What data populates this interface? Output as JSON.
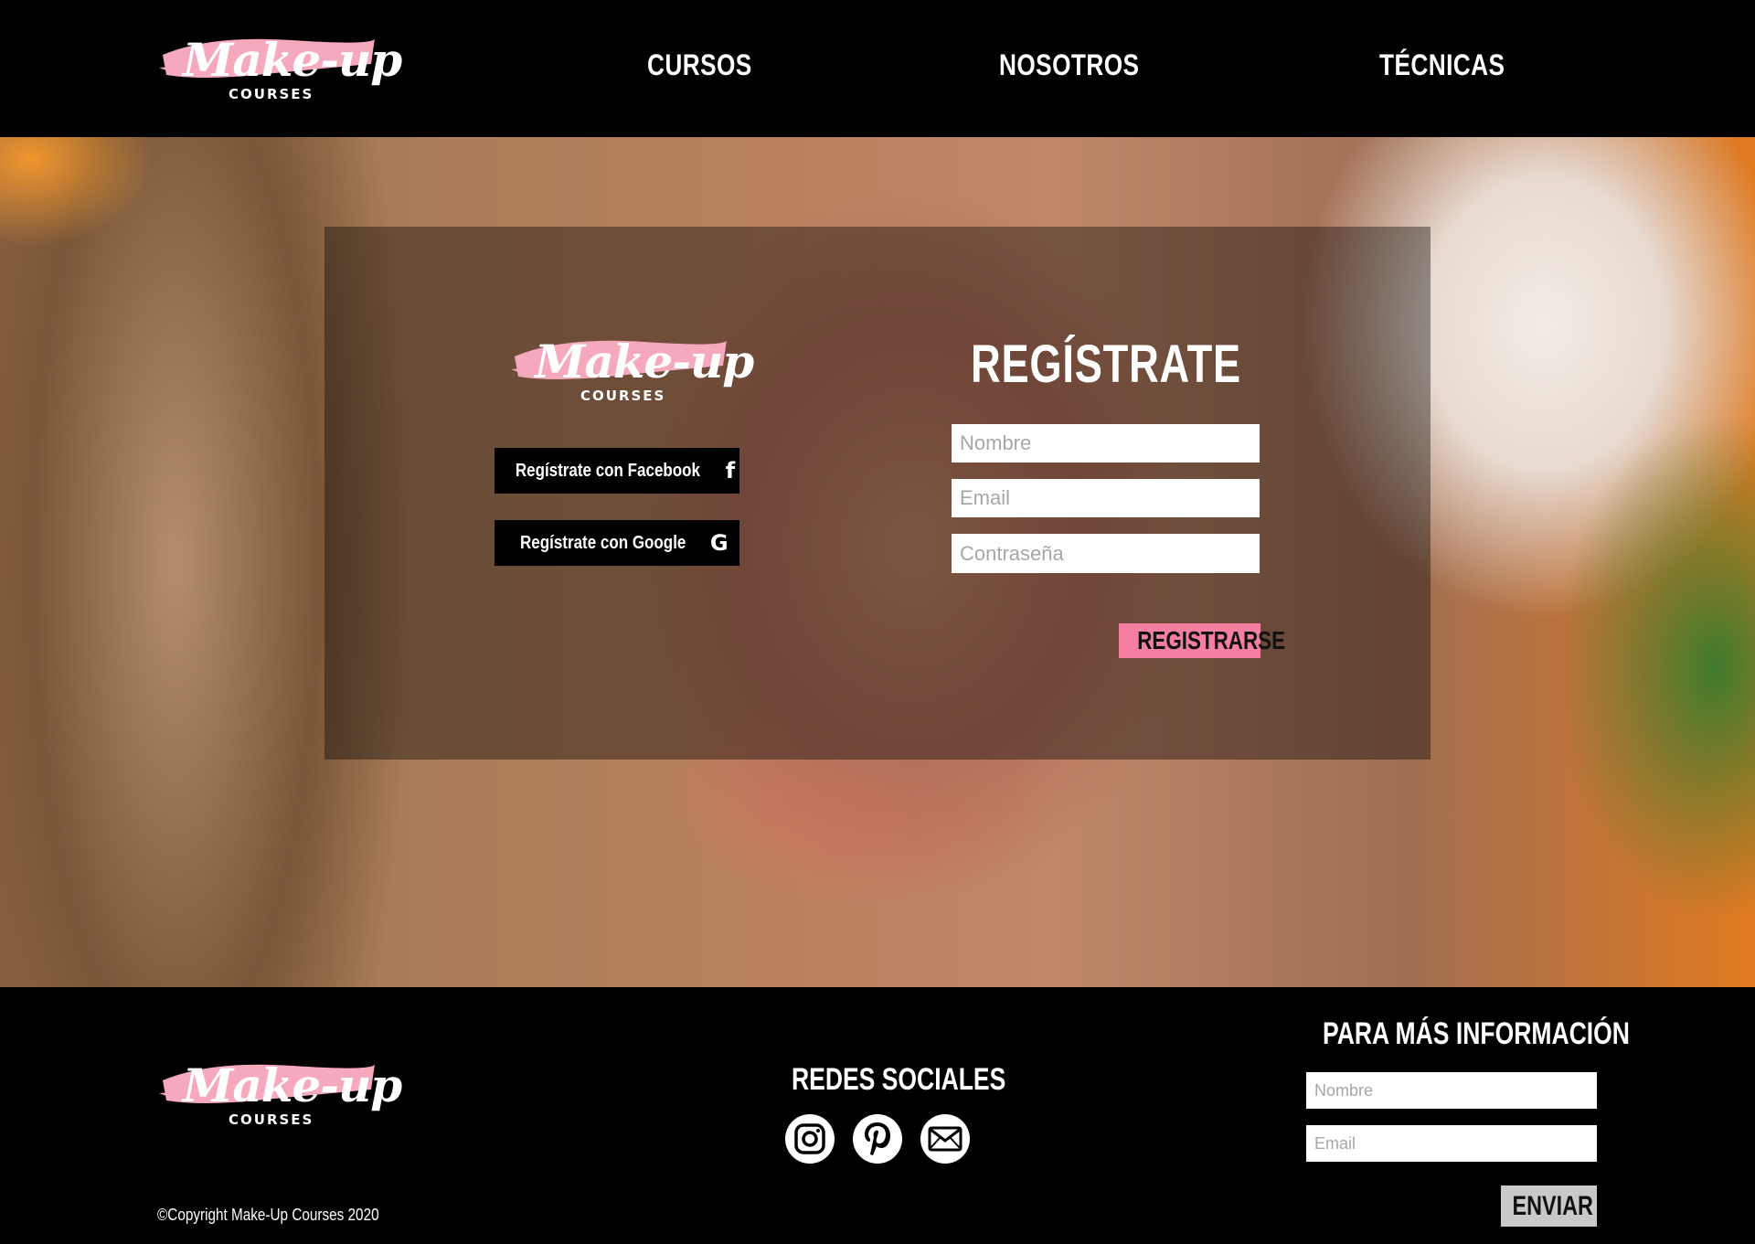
{
  "brand": {
    "script": "Make-up",
    "sub": "COURSES",
    "brush_color": "#f6a9bd"
  },
  "nav": [
    {
      "label": "CURSOS"
    },
    {
      "label": "NOSOTROS"
    },
    {
      "label": "TÉCNICAS"
    }
  ],
  "register": {
    "title": "REGÍSTRATE",
    "facebook_label": "Regístrate con Facebook",
    "facebook_icon": "facebook-icon",
    "google_label": "Regístrate con Google",
    "google_icon": "google-icon",
    "name_placeholder": "Nombre",
    "email_placeholder": "Email",
    "password_placeholder": "Contraseña",
    "submit_label": "REGISTRARSE",
    "accent_color": "#f47fa0"
  },
  "footer": {
    "social_title": "REDES SOCIALES",
    "social_icons": [
      "instagram-icon",
      "pinterest-icon",
      "mail-icon"
    ],
    "info_title": "PARA MÁS INFORMACIÓN",
    "name_placeholder": "Nombre",
    "email_placeholder": "Email",
    "send_label": "ENVIAR",
    "copyright": "©Copyright Make-Up Courses 2020"
  }
}
